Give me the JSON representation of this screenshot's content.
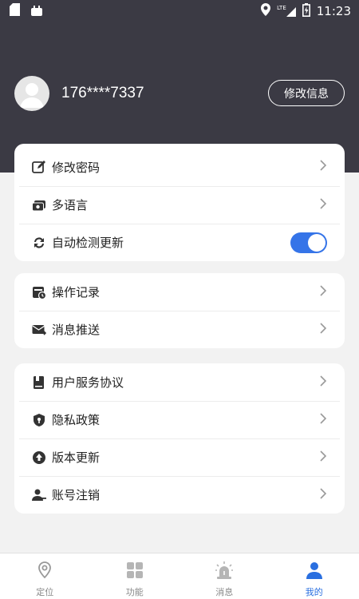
{
  "status_bar": {
    "time": "11:23",
    "network": "LTE"
  },
  "profile": {
    "phone": "176****7337",
    "edit_label": "修改信息"
  },
  "card1": [
    {
      "label": "修改密码",
      "icon": "edit-icon"
    },
    {
      "label": "多语言",
      "icon": "language-icon"
    },
    {
      "label": "自动检测更新",
      "icon": "sync-icon",
      "toggle_on": true
    }
  ],
  "card2": [
    {
      "label": "操作记录",
      "icon": "record-icon"
    },
    {
      "label": "消息推送",
      "icon": "mail-icon"
    }
  ],
  "card3": [
    {
      "label": "用户服务协议",
      "icon": "book-icon"
    },
    {
      "label": "隐私政策",
      "icon": "shield-icon"
    },
    {
      "label": "版本更新",
      "icon": "upgrade-icon"
    },
    {
      "label": "账号注销",
      "icon": "user-remove-icon"
    }
  ],
  "tabs": [
    {
      "label": "定位",
      "icon": "location-icon",
      "active": false
    },
    {
      "label": "功能",
      "icon": "grid-icon",
      "active": false
    },
    {
      "label": "消息",
      "icon": "alarm-icon",
      "active": false
    },
    {
      "label": "我的",
      "icon": "person-icon",
      "active": true
    }
  ],
  "colors": {
    "header": "#3b3a44",
    "accent": "#2a6fe0",
    "toggle": "#3574e8",
    "background": "#f2f2f2"
  }
}
